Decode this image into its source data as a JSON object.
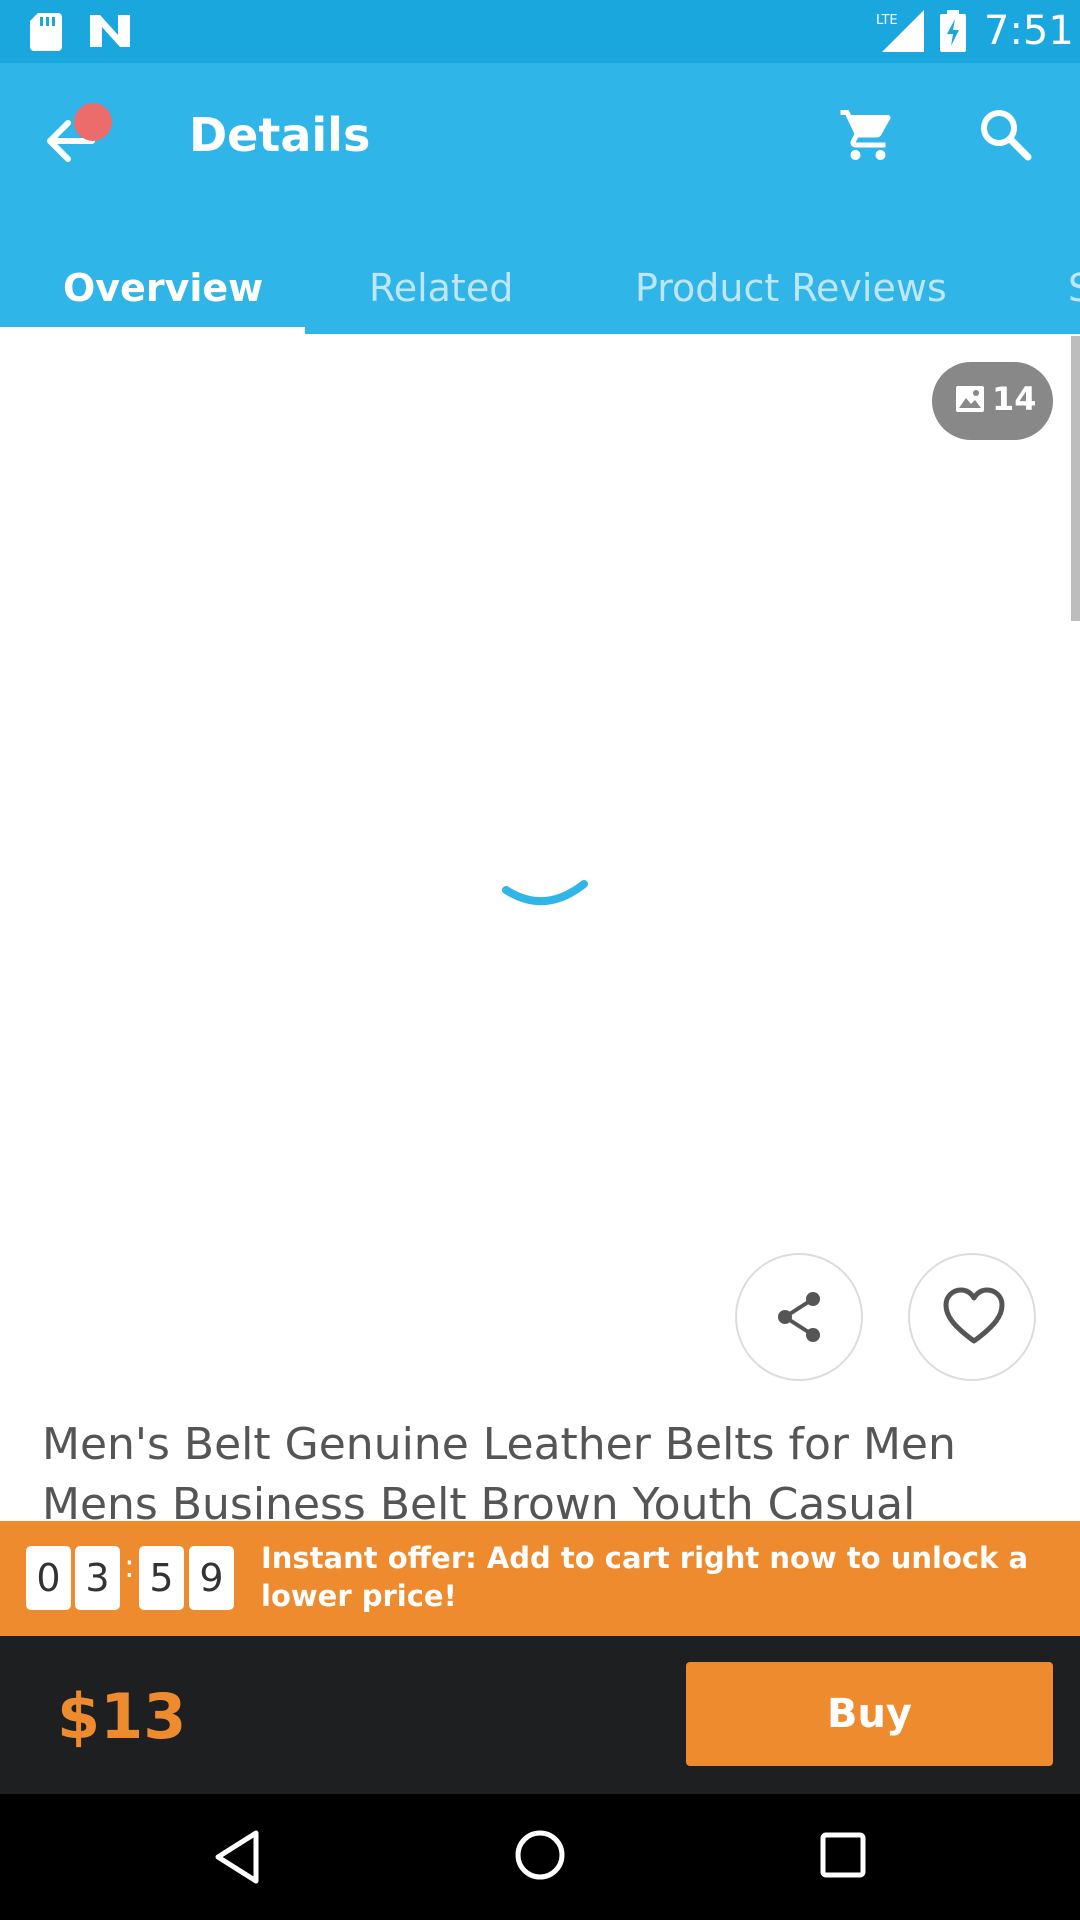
{
  "status_bar": {
    "time": "7:51",
    "network_label": "LTE"
  },
  "toolbar": {
    "title": "Details"
  },
  "tabs": [
    {
      "label": "Overview",
      "active": true
    },
    {
      "label": "Related",
      "active": false
    },
    {
      "label": "Product Reviews",
      "active": false
    },
    {
      "label": "S",
      "active": false
    }
  ],
  "gallery": {
    "photo_count": "14"
  },
  "product": {
    "title": "Men's Belt Genuine Leather Belts for Men Mens Business Belt Brown Youth Casual"
  },
  "offer": {
    "timer_digits": [
      "0",
      "3",
      "5",
      "9"
    ],
    "timer_separator": ":",
    "text": "Instant offer: Add to cart right now to unlock a lower price!"
  },
  "checkout": {
    "price": "$13",
    "buy_label": "Buy"
  },
  "colors": {
    "status_bar": "#1aa7dd",
    "toolbar": "#30b5e8",
    "accent_orange": "#ee8b2e",
    "bottom_bar": "#1d1f21"
  },
  "icons": {
    "status": [
      "sd-card-icon",
      "n-app-icon",
      "signal-icon",
      "battery-charging-icon"
    ],
    "toolbar": [
      "back-arrow-icon",
      "cart-icon",
      "search-icon"
    ],
    "actions": [
      "share-icon",
      "heart-icon"
    ],
    "nav": [
      "nav-back-icon",
      "nav-home-icon",
      "nav-recents-icon"
    ]
  }
}
